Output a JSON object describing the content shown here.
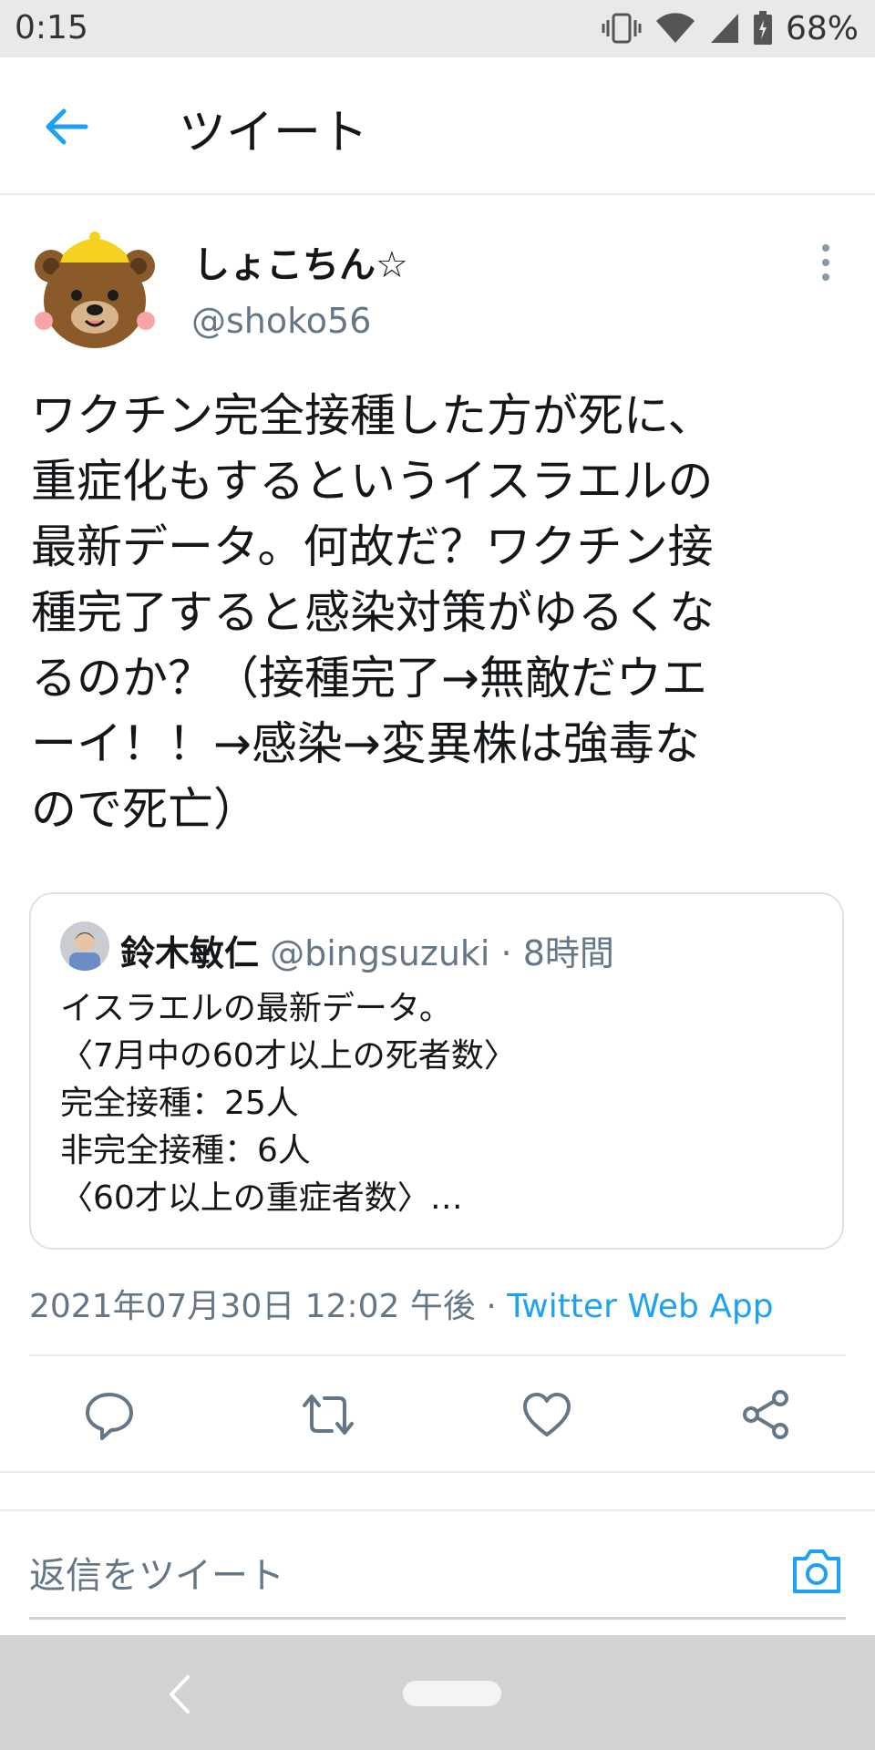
{
  "status_bar": {
    "time": "0:15",
    "battery": "68%"
  },
  "header": {
    "title": "ツイート"
  },
  "tweet": {
    "display_name": "しょこちん☆",
    "handle": "@shoko56",
    "text": "ワクチン完全接種した方が死に、\n重症化もするというイスラエルの\n最新データ。何故だ？ワクチン接\n種完了すると感染対策がゆるくな\nるのか？（接種完了→無敵だウエ\nーイ！！→感染→変異株は強毒な\nので死亡）"
  },
  "quote": {
    "name": "鈴木敏仁",
    "handle": "@bingsuzuki",
    "separator": " · ",
    "time": "8時間",
    "body": "イスラエルの最新データ。\n〈7月中の60才以上の死者数〉\n完全接種：25人\n非完全接種：6人\n〈60才以上の重症者数〉…"
  },
  "meta": {
    "date": "2021年07月30日 12:02 午後",
    "separator": " · ",
    "app": "Twitter Web App"
  },
  "reply": {
    "placeholder": "返信をツイート"
  },
  "colors": {
    "accent": "#1da1f2",
    "secondary_text": "#657786"
  }
}
